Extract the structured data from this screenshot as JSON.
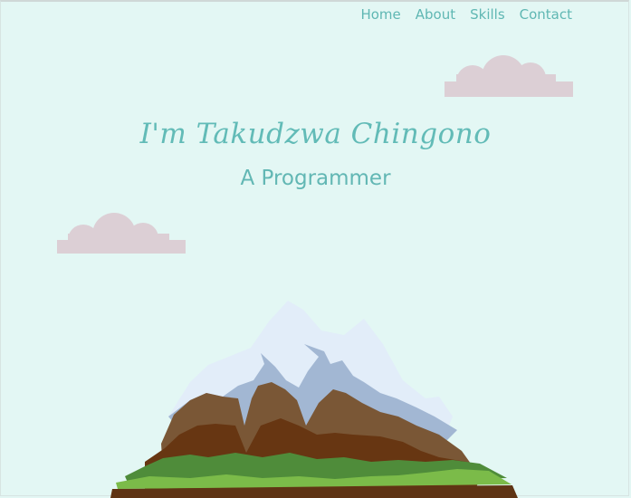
{
  "nav": {
    "items": [
      {
        "label": "Home"
      },
      {
        "label": "About"
      },
      {
        "label": "Skills"
      },
      {
        "label": "Contact"
      }
    ]
  },
  "hero": {
    "name": "I'm Takudzwa Chingono",
    "role": "A Programmer"
  },
  "colors": {
    "background": "#e3f7f4",
    "accent": "#62bbb7",
    "cloud": "#dccfd5",
    "snow": "#e2edf9",
    "snow_shadow": "#a2b7d3",
    "rock_light": "#7a5736",
    "rock_dark": "#673612",
    "grass_dark": "#4f8c3a",
    "grass_light": "#7bbb49",
    "soil": "#5f3414"
  }
}
